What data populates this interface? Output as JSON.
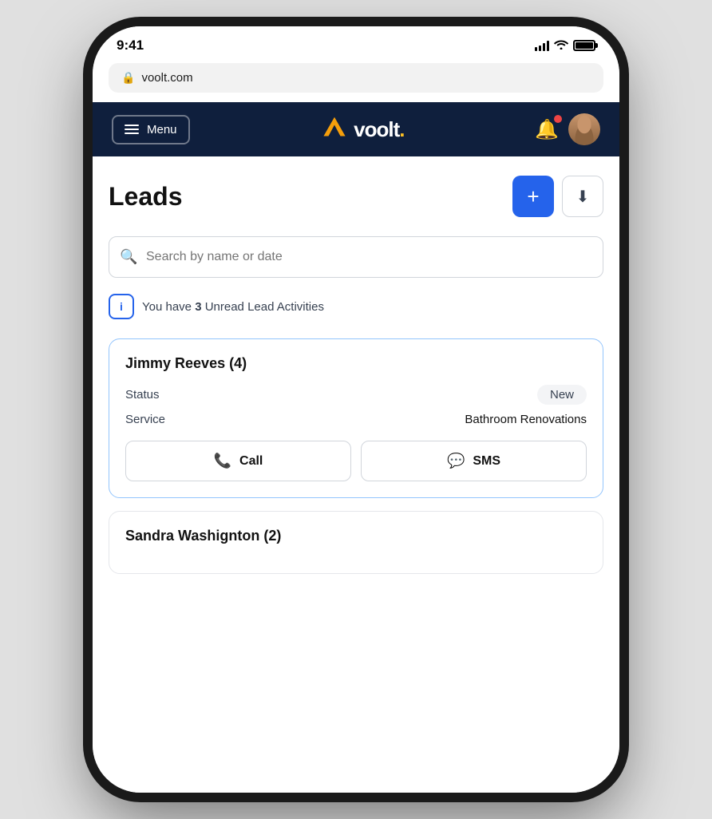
{
  "phone": {
    "time": "9:41",
    "url": "voolt.com"
  },
  "nav": {
    "menu_label": "Menu",
    "brand_name": "voolt",
    "brand_dot": ".",
    "notification_count": 1
  },
  "page": {
    "title": "Leads",
    "add_label": "+",
    "search_placeholder": "Search by name or date"
  },
  "alert": {
    "prefix": "You have ",
    "count": "3",
    "suffix": " Unread Lead Activities"
  },
  "leads": [
    {
      "name": "Jimmy Reeves (4)",
      "status_label": "Status",
      "status_value": "New",
      "service_label": "Service",
      "service_value": "Bathroom Renovations",
      "call_label": "Call",
      "sms_label": "SMS"
    },
    {
      "name": "Sandra Washignton (2)"
    }
  ]
}
